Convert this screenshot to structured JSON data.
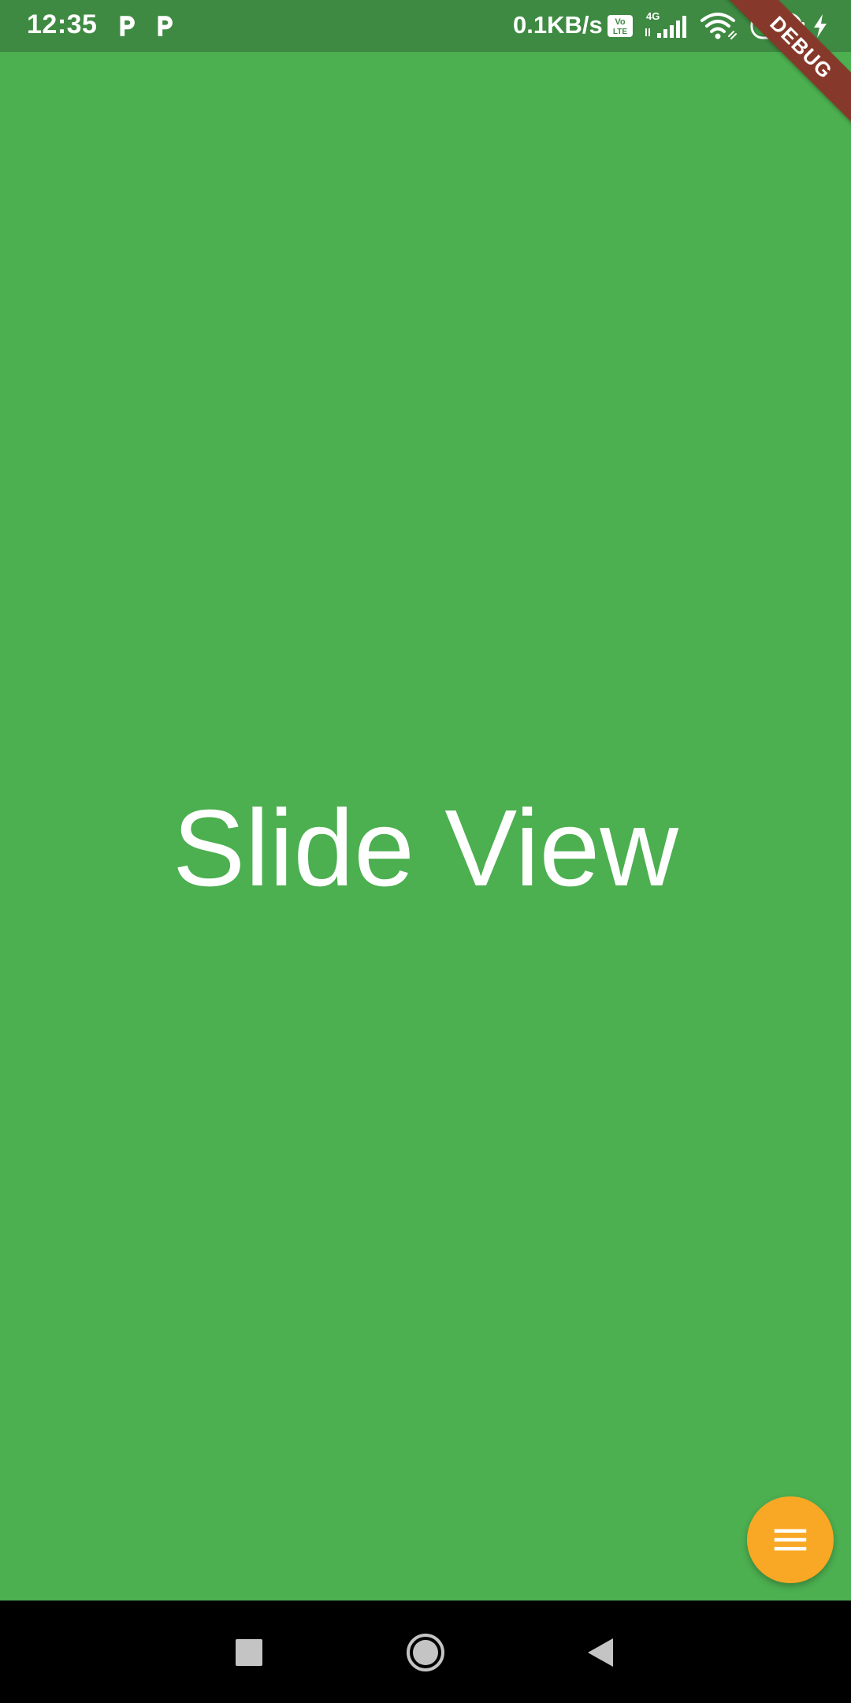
{
  "status_bar": {
    "time": "12:35",
    "net_speed": "0.1KB/s",
    "network_type": "4G",
    "volte_label_top": "Vo",
    "volte_label_bottom": "LTE",
    "battery_level": "64",
    "notification_icons": [
      "parking-p-icon",
      "parking-p-icon"
    ],
    "icons": [
      "volte-icon",
      "signal-icon",
      "wifi-icon",
      "battery-icon",
      "charging-icon"
    ]
  },
  "debug_banner": {
    "label": "DEBUG",
    "color": "#86392a"
  },
  "main": {
    "title": "Slide View",
    "background_color": "#4caf50"
  },
  "fab": {
    "icon": "menu-icon",
    "color": "#f9a825"
  },
  "nav_bar": {
    "buttons": [
      "recents-icon",
      "home-icon",
      "back-icon"
    ]
  }
}
